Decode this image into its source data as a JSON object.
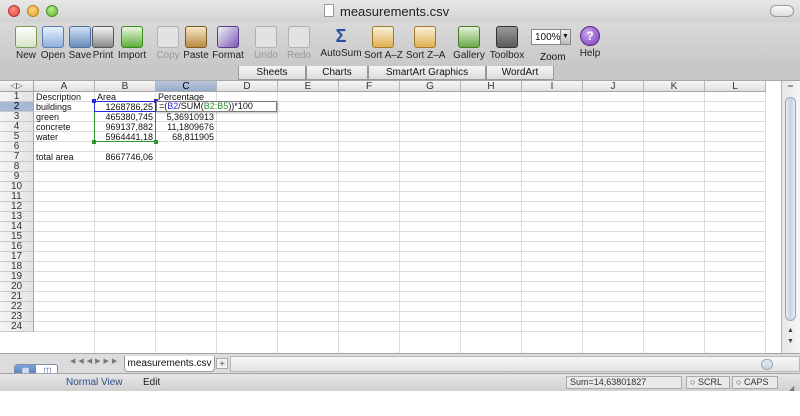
{
  "window": {
    "title": "measurements.csv"
  },
  "toolbar": {
    "buttons": [
      {
        "label": "New",
        "icon": "new-document-icon",
        "enabled": true
      },
      {
        "label": "Open",
        "icon": "open-folder-icon",
        "enabled": true
      },
      {
        "label": "Save",
        "icon": "save-icon",
        "enabled": true
      },
      {
        "label": "Print",
        "icon": "printer-icon",
        "enabled": true
      },
      {
        "label": "Import",
        "icon": "import-icon",
        "enabled": true
      },
      {
        "label": "Copy",
        "icon": "copy-icon",
        "enabled": false
      },
      {
        "label": "Paste",
        "icon": "paste-icon",
        "enabled": true
      },
      {
        "label": "Format",
        "icon": "format-brush-icon",
        "enabled": true
      },
      {
        "label": "Undo",
        "icon": "undo-icon",
        "enabled": false
      },
      {
        "label": "Redo",
        "icon": "redo-icon",
        "enabled": false
      },
      {
        "label": "AutoSum",
        "icon": "sigma-icon",
        "enabled": true
      },
      {
        "label": "Sort A–Z",
        "icon": "sort-ascending-icon",
        "enabled": true
      },
      {
        "label": "Sort Z–A",
        "icon": "sort-descending-icon",
        "enabled": true
      },
      {
        "label": "Gallery",
        "icon": "gallery-icon",
        "enabled": true
      },
      {
        "label": "Toolbox",
        "icon": "toolbox-icon",
        "enabled": true
      },
      {
        "label": "Zoom",
        "icon": "zoom-icon",
        "enabled": true
      },
      {
        "label": "Help",
        "icon": "help-icon",
        "enabled": true
      }
    ],
    "zoom_value": "100%"
  },
  "ribbon": {
    "tabs": [
      "Sheets",
      "Charts",
      "SmartArt Graphics",
      "WordArt"
    ]
  },
  "grid": {
    "columns": [
      "A",
      "B",
      "C",
      "D",
      "E",
      "F",
      "G",
      "H",
      "I",
      "J",
      "K",
      "L"
    ],
    "rows": [
      "1",
      "2",
      "3",
      "4",
      "5",
      "6",
      "7",
      "8",
      "9",
      "10",
      "11",
      "12",
      "13",
      "14",
      "15",
      "16",
      "17",
      "18",
      "19",
      "20",
      "21",
      "22",
      "23",
      "24"
    ],
    "selected_column": "C",
    "selected_row": "2",
    "cells": {
      "A1": "Description",
      "B1": "Area",
      "C1": "Percentage",
      "A2": "buildings",
      "B2": "1268786,25",
      "A3": "green",
      "B3": "465380,745",
      "C3": "5,36910913",
      "A4": "concrete",
      "B4": "969137,882",
      "C4": "11,1809676",
      "A5": "water",
      "B5": "5964441,18",
      "C5": "68,811905",
      "A7": "total area",
      "B7": "8667746,06"
    },
    "editing_formula": {
      "prefix": "=(",
      "ref1": "B2",
      "mid": "/SUM(",
      "ref2": "B2:B5",
      "suffix": "))*100"
    }
  },
  "sheets": {
    "tabs": [
      "measurements.csv"
    ]
  },
  "status": {
    "view": "Normal View",
    "mode": "Edit",
    "sum": "Sum=14,63801827",
    "scrl": "SCRL",
    "caps": "CAPS"
  },
  "colors": {
    "selection_blue": "#2a2ad8",
    "range_green": "#2d9a2d",
    "header_selected": "#a6b8d4"
  }
}
